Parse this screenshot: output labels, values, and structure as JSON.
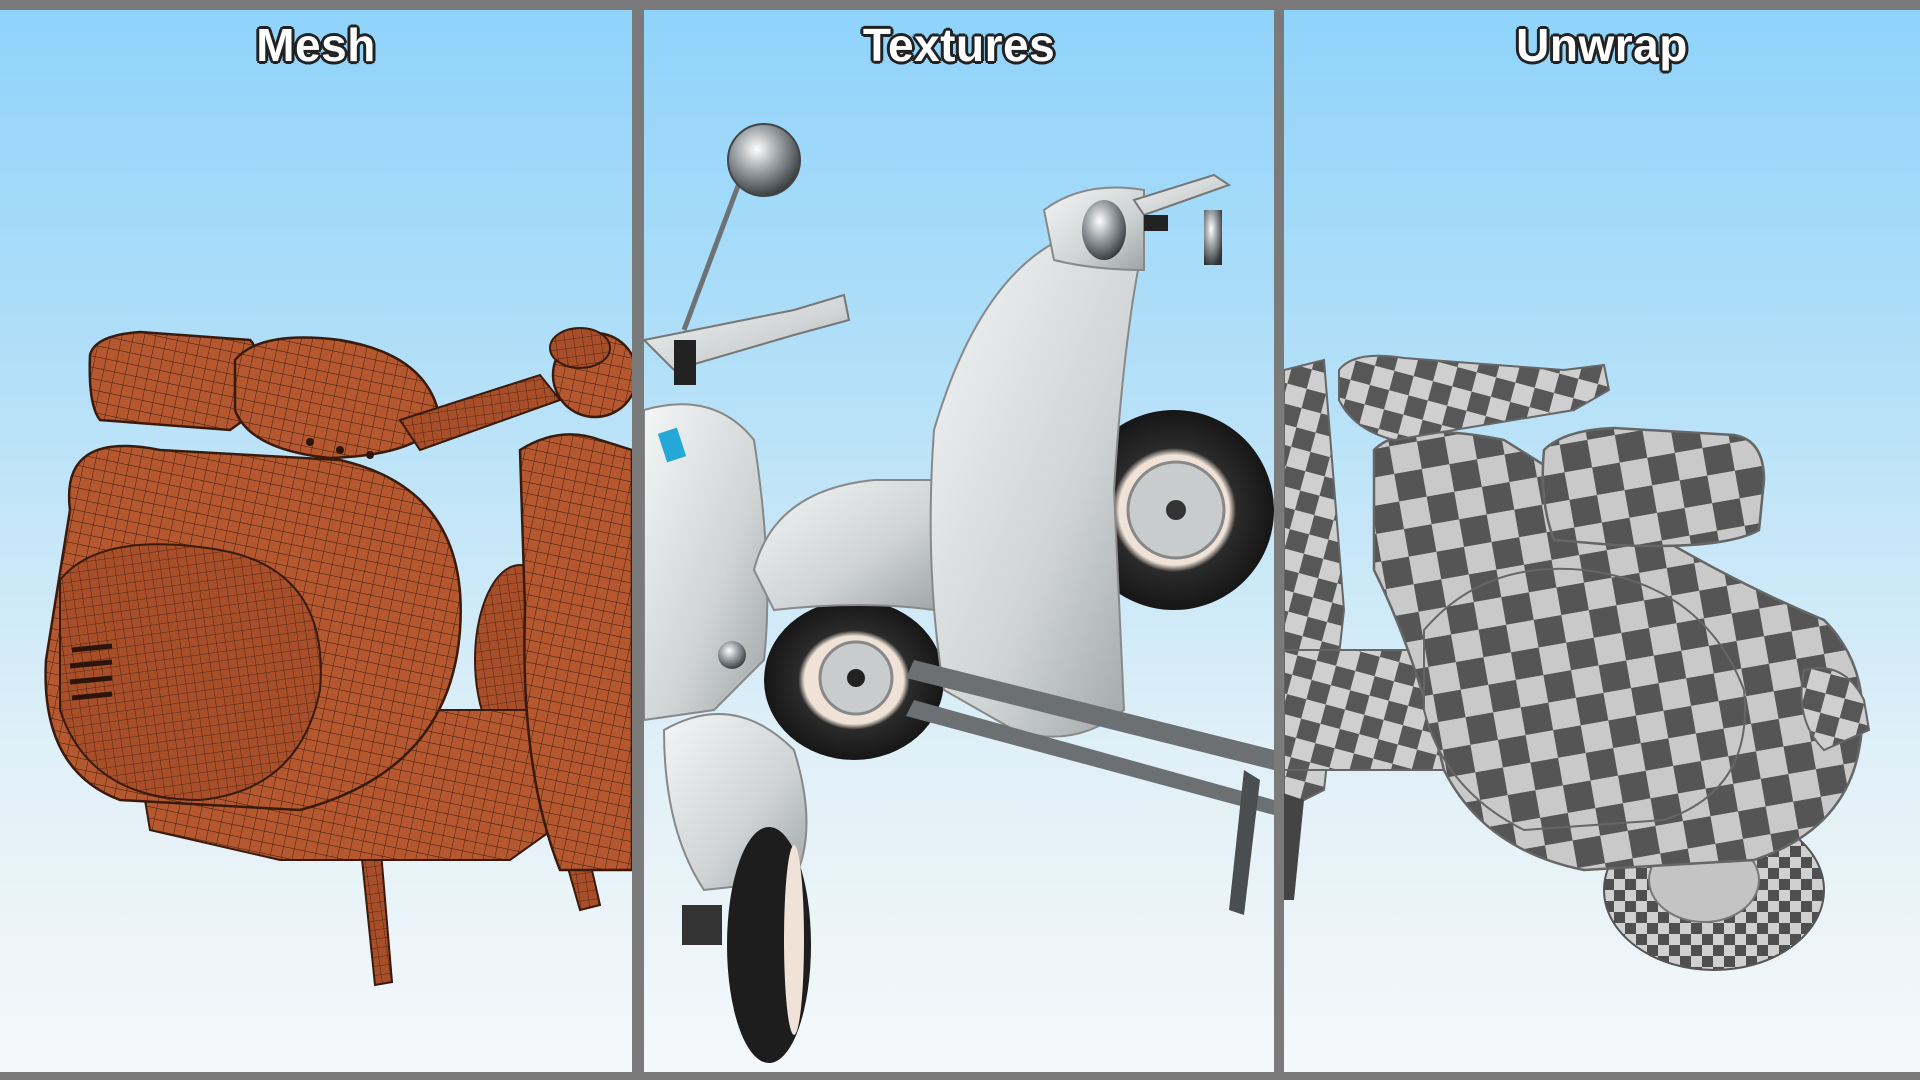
{
  "panels": {
    "mesh": {
      "title": "Mesh"
    },
    "textures": {
      "title": "Textures"
    },
    "unwrap": {
      "title": "Unwrap"
    }
  },
  "colors": {
    "sky_top": "#8fd3fb",
    "sky_bottom": "#f5f8f9",
    "divider": "#7a7a7a",
    "mesh_body": "#b5582f",
    "texture_body": "#d9dcdc",
    "checker_dark": "#555555",
    "checker_light": "#c8c8c8"
  }
}
